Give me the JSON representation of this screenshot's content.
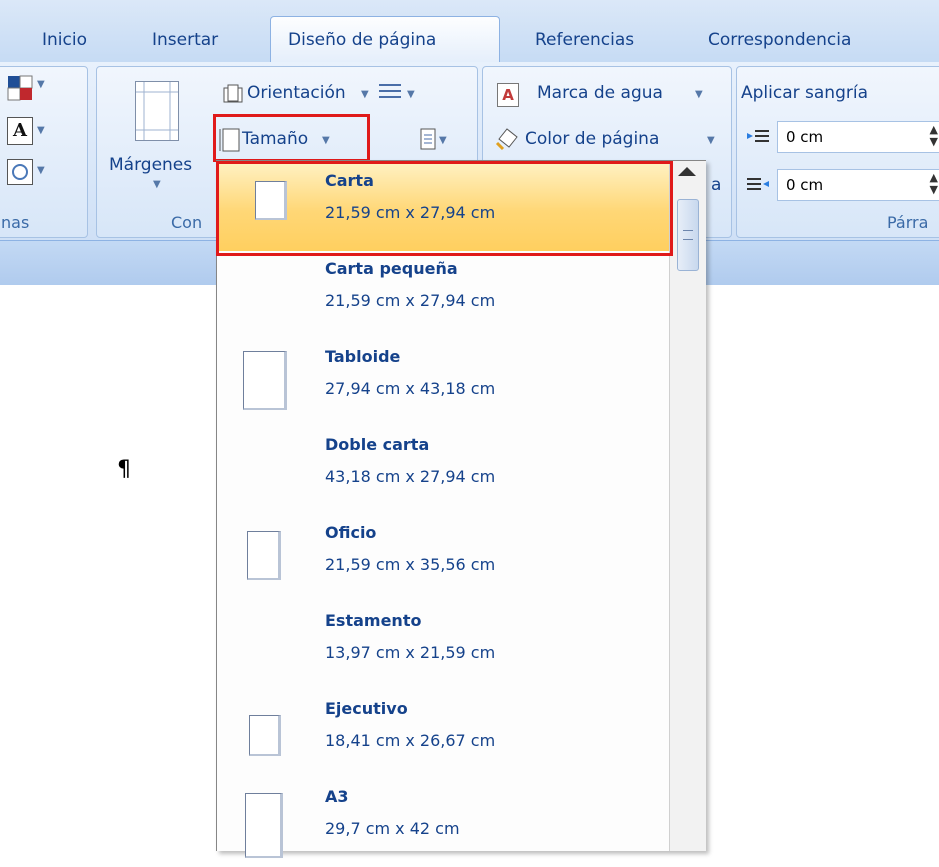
{
  "tabs": {
    "inicio": "Inicio",
    "insertar": "Insertar",
    "diseno": "Diseño de página",
    "referencias": "Referencias",
    "correspondencia": "Correspondencia"
  },
  "ribbon": {
    "temas_label": "nas",
    "configurar_label": "Con",
    "margenes": "Márgenes",
    "orientacion": "Orientación",
    "tamano": "Tamaño",
    "marca_agua": "Marca de agua",
    "color_pagina": "Color de página",
    "bordes_partial": "a",
    "aplicar_sangria": "Aplicar sangría",
    "sangria_izq": "0 cm",
    "sangria_der": "0 cm",
    "parrafo_label": "Párra"
  },
  "document": {
    "pilcrow": "¶"
  },
  "dropdown": {
    "items": [
      {
        "name": "Carta",
        "size": "21,59 cm x 27,94 cm",
        "selected": true
      },
      {
        "name": "Carta pequeña",
        "size": "21,59 cm x 27,94 cm",
        "selected": false
      },
      {
        "name": "Tabloide",
        "size": "27,94 cm x 43,18 cm",
        "selected": false
      },
      {
        "name": "Doble carta",
        "size": "43,18 cm x 27,94 cm",
        "selected": false
      },
      {
        "name": "Oficio",
        "size": "21,59 cm x 35,56 cm",
        "selected": false
      },
      {
        "name": "Estamento",
        "size": "13,97 cm x 21,59 cm",
        "selected": false
      },
      {
        "name": "Ejecutivo",
        "size": "18,41 cm x 26,67 cm",
        "selected": false
      },
      {
        "name": "A3",
        "size": "29,7 cm x 42 cm",
        "selected": false
      }
    ]
  },
  "colors": {
    "highlight": "#e01a1a",
    "selected_item": "#ffd776",
    "text_blue": "#15428b",
    "ribbon_bg": "#dbe8f8"
  }
}
